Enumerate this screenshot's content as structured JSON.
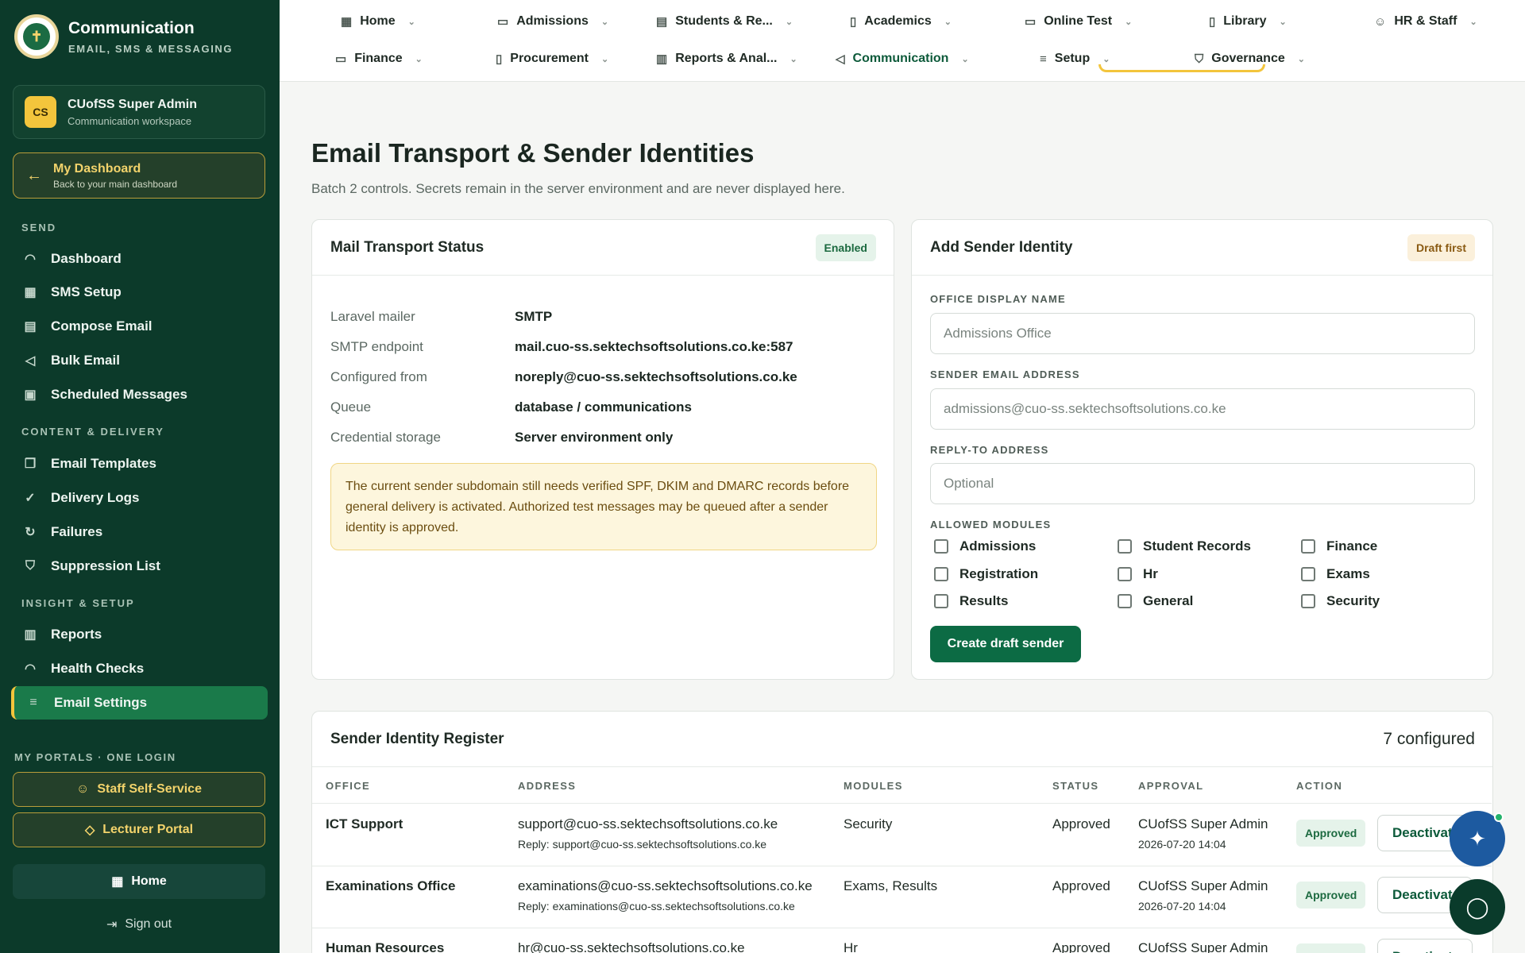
{
  "brand": {
    "title": "Communication",
    "subtitle": "EMAIL, SMS & MESSAGING",
    "logo_glyph": "✝"
  },
  "user": {
    "initials": "CS",
    "name": "CUofSS Super Admin",
    "workspace": "Communication workspace"
  },
  "dashboard": {
    "title": "My Dashboard",
    "subtitle": "Back to your main dashboard"
  },
  "sidebar": {
    "sections": [
      {
        "label": "SEND",
        "items": [
          {
            "label": "Dashboard",
            "icon": "gauge-icon",
            "glyph": "◠"
          },
          {
            "label": "SMS Setup",
            "icon": "grid-icon",
            "glyph": "▦"
          },
          {
            "label": "Compose Email",
            "icon": "document-icon",
            "glyph": "▤"
          },
          {
            "label": "Bulk Email",
            "icon": "megaphone-icon",
            "glyph": "◁"
          },
          {
            "label": "Scheduled Messages",
            "icon": "calendar-icon",
            "glyph": "▣"
          }
        ]
      },
      {
        "label": "CONTENT & DELIVERY",
        "items": [
          {
            "label": "Email Templates",
            "icon": "copy-icon",
            "glyph": "❐"
          },
          {
            "label": "Delivery Logs",
            "icon": "check-circle-icon",
            "glyph": "✓"
          },
          {
            "label": "Failures",
            "icon": "refresh-icon",
            "glyph": "↻"
          },
          {
            "label": "Suppression List",
            "icon": "shield-icon",
            "glyph": "⛉"
          }
        ]
      },
      {
        "label": "INSIGHT & SETUP",
        "items": [
          {
            "label": "Reports",
            "icon": "bar-chart-icon",
            "glyph": "▥"
          },
          {
            "label": "Health Checks",
            "icon": "gauge-icon",
            "glyph": "◠"
          },
          {
            "label": "Email Settings",
            "icon": "sliders-icon",
            "glyph": "≡",
            "active": true
          }
        ]
      }
    ],
    "portals_label": "MY PORTALS · ONE LOGIN",
    "portals": [
      {
        "label": "Staff Self-Service",
        "icon": "user-icon",
        "glyph": "☺"
      },
      {
        "label": "Lecturer Portal",
        "icon": "graduation-cap-icon",
        "glyph": "◇"
      }
    ],
    "home_label": "Home",
    "signout_label": "Sign out"
  },
  "topnav": [
    {
      "label": "Home",
      "icon": "grid-icon",
      "glyph": "▦"
    },
    {
      "label": "Admissions",
      "icon": "inbox-icon",
      "glyph": "▭"
    },
    {
      "label": "Students & Re...",
      "icon": "id-card-icon",
      "glyph": "▤"
    },
    {
      "label": "Academics",
      "icon": "clipboard-icon",
      "glyph": "▯"
    },
    {
      "label": "Online Test",
      "icon": "monitor-icon",
      "glyph": "▭"
    },
    {
      "label": "Library",
      "icon": "book-icon",
      "glyph": "▯"
    },
    {
      "label": "HR & Staff",
      "icon": "users-icon",
      "glyph": "☺"
    },
    {
      "label": "Finance",
      "icon": "wallet-icon",
      "glyph": "▭"
    },
    {
      "label": "Procurement",
      "icon": "clipboard-icon",
      "glyph": "▯"
    },
    {
      "label": "Reports & Anal...",
      "icon": "bar-chart-icon",
      "glyph": "▥"
    },
    {
      "label": "Communication",
      "icon": "megaphone-icon",
      "glyph": "◁",
      "active": true
    },
    {
      "label": "Setup",
      "icon": "sliders-icon",
      "glyph": "≡"
    },
    {
      "label": "Governance",
      "icon": "shield-check-icon",
      "glyph": "⛉"
    }
  ],
  "page": {
    "title": "Email Transport & Sender Identities",
    "subtitle": "Batch 2 controls. Secrets remain in the server environment and are never displayed here."
  },
  "transport": {
    "title": "Mail Transport Status",
    "badge": "Enabled",
    "rows": [
      {
        "key": "Laravel mailer",
        "value": "SMTP"
      },
      {
        "key": "SMTP endpoint",
        "value": "mail.cuo-ss.sektechsoftsolutions.co.ke:587"
      },
      {
        "key": "Configured from",
        "value": "noreply@cuo-ss.sektechsoftsolutions.co.ke"
      },
      {
        "key": "Queue",
        "value": "database / communications"
      },
      {
        "key": "Credential storage",
        "value": "Server environment only"
      }
    ],
    "warning": "The current sender subdomain still needs verified SPF, DKIM and DMARC records before general delivery is activated. Authorized test messages may be queued after a sender identity is approved."
  },
  "sender_form": {
    "title": "Add Sender Identity",
    "badge": "Draft first",
    "display_name_label": "OFFICE DISPLAY NAME",
    "display_name_placeholder": "Admissions Office",
    "email_label": "SENDER EMAIL ADDRESS",
    "email_placeholder": "admissions@cuo-ss.sektechsoftsolutions.co.ke",
    "reply_label": "REPLY-TO ADDRESS",
    "reply_placeholder": "Optional",
    "modules_label": "ALLOWED MODULES",
    "modules": [
      "Admissions",
      "Student Records",
      "Finance",
      "Registration",
      "Hr",
      "Exams",
      "Results",
      "General",
      "Security"
    ],
    "submit_label": "Create draft sender"
  },
  "register": {
    "title": "Sender Identity Register",
    "count": "7 configured",
    "columns": [
      "OFFICE",
      "ADDRESS",
      "MODULES",
      "STATUS",
      "APPROVAL",
      "ACTION"
    ],
    "rows": [
      {
        "office": "ICT Support",
        "address": "support@cuo-ss.sektechsoftsolutions.co.ke",
        "reply": "Reply: support@cuo-ss.sektechsoftsolutions.co.ke",
        "modules": "Security",
        "status": "Approved",
        "approver": "CUofSS Super Admin",
        "approved_at": "2026-07-20 14:04",
        "badge": "Approved",
        "action": "Deactivate"
      },
      {
        "office": "Examinations Office",
        "address": "examinations@cuo-ss.sektechsoftsolutions.co.ke",
        "reply": "Reply: examinations@cuo-ss.sektechsoftsolutions.co.ke",
        "modules": "Exams, Results",
        "status": "Approved",
        "approver": "CUofSS Super Admin",
        "approved_at": "2026-07-20 14:04",
        "badge": "Approved",
        "action": "Deactivate"
      },
      {
        "office": "Human Resources",
        "address": "hr@cuo-ss.sektechsoftsolutions.co.ke",
        "modules": "Hr",
        "status": "Approved",
        "approver": "CUofSS Super Admin",
        "badge": "Approved",
        "action": "Deactivate"
      }
    ]
  },
  "fabs": {
    "assistant_glyph": "✦",
    "chat_glyph": "◯"
  }
}
